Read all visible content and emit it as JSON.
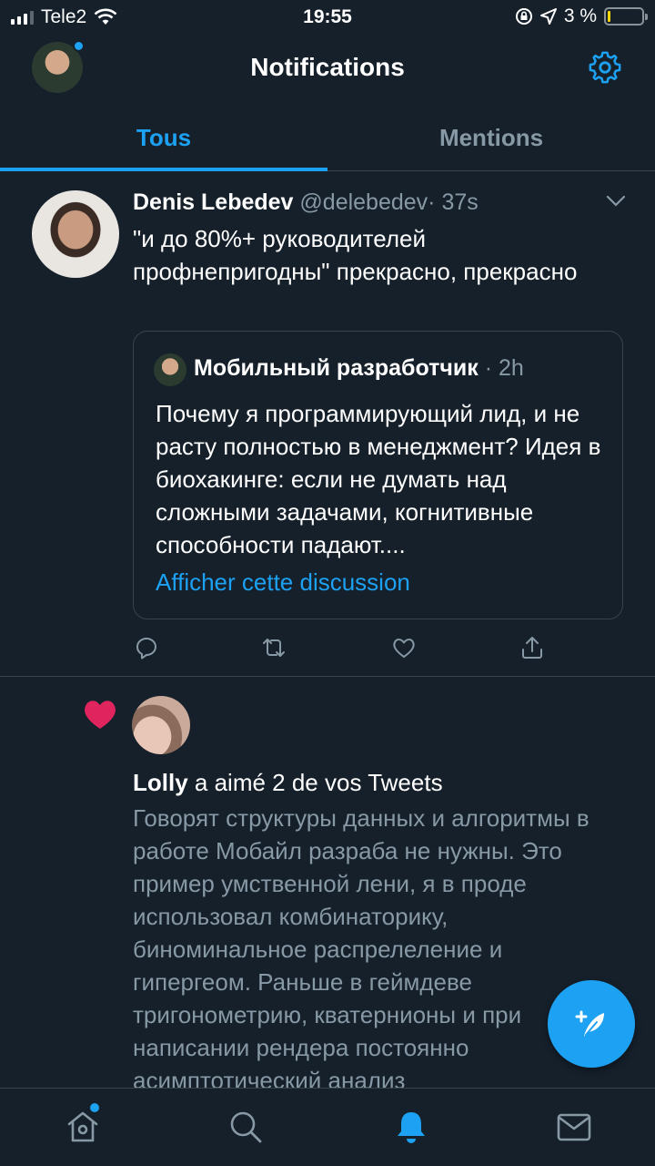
{
  "status_bar": {
    "carrier": "Tele2",
    "time": "19:55",
    "battery_percent": "3 %"
  },
  "header": {
    "title": "Notifications"
  },
  "tabs": [
    {
      "label": "Tous",
      "active": true
    },
    {
      "label": "Mentions",
      "active": false
    }
  ],
  "tweet": {
    "name": "Denis Lebedev",
    "handle": "@delebedev",
    "time": "· 37s",
    "text": "\"и до 80%+ руководителей профнепригодны\" прекрасно, прекрасно",
    "quote": {
      "name": "Мобильный разработчик",
      "time": "· 2h",
      "text": "Почему я программирующий лид, и не расту полностью в менеджмент? Идея в биохакинге: если не думать над сложными задачами, когнитивные способности падают....",
      "link": "Afficher cette discussion"
    }
  },
  "like_notification": {
    "name": "Lolly",
    "action": " a aimé 2 de vos Tweets",
    "text": "Говорят структуры данных и алгоритмы в работе Мобайл разраба не нужны. Это пример умственной лени, я в проде использовал комбинаторику, биноминальное  распрелеление и гипергеом. Раньше в геймдеве тригонометрию, кватернионы и при написании рендера постоянно асимптотический анализ"
  },
  "colors": {
    "background": "#15202b",
    "accent": "#1da1f2",
    "secondary_text": "#8899a6",
    "divider": "#38444d",
    "like": "#e0245e"
  },
  "icons": {
    "header": [
      "gear-icon"
    ],
    "tweet_actions": [
      "reply-icon",
      "retweet-icon",
      "like-icon",
      "share-icon"
    ],
    "bottom_nav": [
      "home-icon",
      "search-icon",
      "notifications-icon",
      "messages-icon"
    ],
    "fab": "compose-icon"
  }
}
